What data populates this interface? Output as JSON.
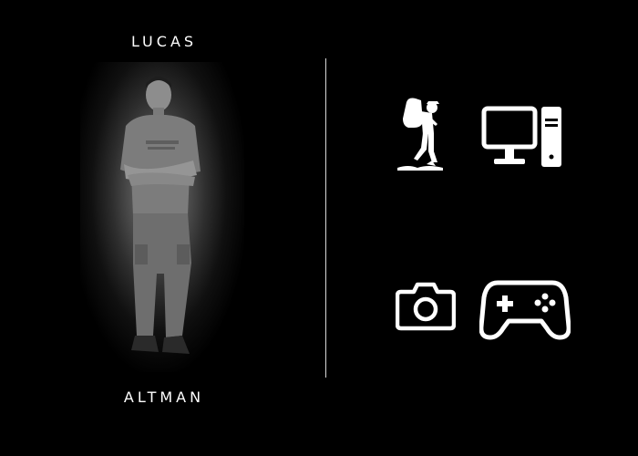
{
  "profile": {
    "first_name": "LUCAS",
    "last_name": "ALTMAN"
  },
  "interests": {
    "icons": [
      "hiker-icon",
      "desktop-computer-icon",
      "camera-icon",
      "gamepad-icon"
    ]
  },
  "colors": {
    "background": "#000000",
    "text": "#ffffff",
    "divider": "#d8d8d8"
  }
}
